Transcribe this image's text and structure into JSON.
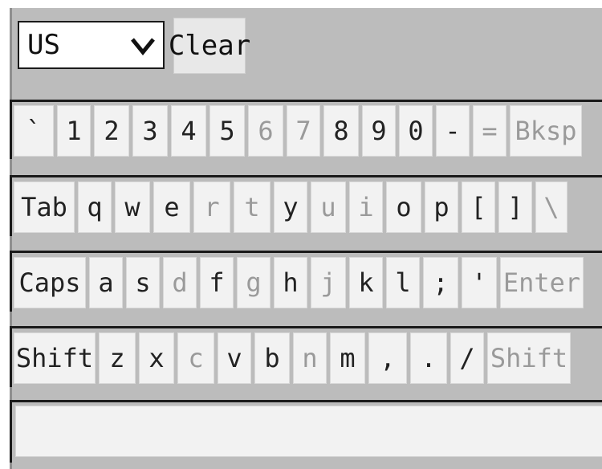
{
  "layout_select": {
    "value": "US"
  },
  "clear_button": {
    "label": "Clear"
  },
  "rows": {
    "r1": [
      {
        "label": "`",
        "dim": false
      },
      {
        "label": "1",
        "dim": false
      },
      {
        "label": "2",
        "dim": false
      },
      {
        "label": "3",
        "dim": false
      },
      {
        "label": "4",
        "dim": false
      },
      {
        "label": "5",
        "dim": false
      },
      {
        "label": "6",
        "dim": true
      },
      {
        "label": "7",
        "dim": true
      },
      {
        "label": "8",
        "dim": false
      },
      {
        "label": "9",
        "dim": false
      },
      {
        "label": "0",
        "dim": false
      },
      {
        "label": "-",
        "dim": false
      },
      {
        "label": "=",
        "dim": true
      },
      {
        "label": "Bksp",
        "dim": true
      }
    ],
    "r2": [
      {
        "label": "Tab",
        "dim": false
      },
      {
        "label": "q",
        "dim": false
      },
      {
        "label": "w",
        "dim": false
      },
      {
        "label": "e",
        "dim": false
      },
      {
        "label": "r",
        "dim": true
      },
      {
        "label": "t",
        "dim": true
      },
      {
        "label": "y",
        "dim": false
      },
      {
        "label": "u",
        "dim": true
      },
      {
        "label": "i",
        "dim": true
      },
      {
        "label": "o",
        "dim": false
      },
      {
        "label": "p",
        "dim": false
      },
      {
        "label": "[",
        "dim": false
      },
      {
        "label": "]",
        "dim": false
      },
      {
        "label": "\\",
        "dim": true
      }
    ],
    "r3": [
      {
        "label": "Caps",
        "dim": false
      },
      {
        "label": "a",
        "dim": false
      },
      {
        "label": "s",
        "dim": false
      },
      {
        "label": "d",
        "dim": true
      },
      {
        "label": "f",
        "dim": false
      },
      {
        "label": "g",
        "dim": true
      },
      {
        "label": "h",
        "dim": false
      },
      {
        "label": "j",
        "dim": true
      },
      {
        "label": "k",
        "dim": false
      },
      {
        "label": "l",
        "dim": false
      },
      {
        "label": ";",
        "dim": false
      },
      {
        "label": "'",
        "dim": false
      },
      {
        "label": "Enter",
        "dim": true
      }
    ],
    "r4": [
      {
        "label": "Shift",
        "dim": false
      },
      {
        "label": "z",
        "dim": false
      },
      {
        "label": "x",
        "dim": false
      },
      {
        "label": "c",
        "dim": true
      },
      {
        "label": "v",
        "dim": false
      },
      {
        "label": "b",
        "dim": false
      },
      {
        "label": "n",
        "dim": true
      },
      {
        "label": "m",
        "dim": false
      },
      {
        "label": ",",
        "dim": false
      },
      {
        "label": ".",
        "dim": false
      },
      {
        "label": "/",
        "dim": false
      },
      {
        "label": "Shift",
        "dim": true
      }
    ]
  },
  "output": {
    "value": ""
  },
  "colors": {
    "panel": "#bcbcbc",
    "key": "#f2f2f2",
    "dim_text": "#9a9a9a"
  }
}
